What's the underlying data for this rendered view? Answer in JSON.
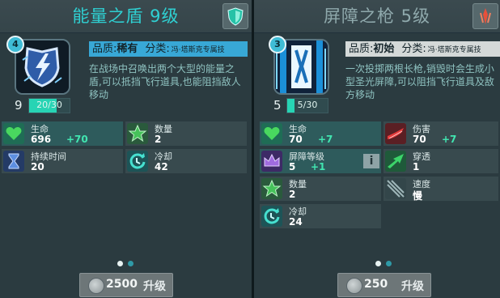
{
  "left": {
    "title": "能量之盾 9级",
    "level_badge": "4",
    "progress": {
      "level": "9",
      "text": "20/30",
      "fraction": 0.67
    },
    "quality_label": "品质:",
    "quality_value": "稀有",
    "category_label": "分类:",
    "category_value": "冯·塔斯克专属技",
    "description": "在战场中召唤出两个大型的能量之盾,可以抵挡飞行道具,也能阻挡敌人移动",
    "stats": [
      {
        "label": "生命",
        "value": "696",
        "bonus": "+70",
        "icon": "heart-icon"
      },
      {
        "label": "数量",
        "value": "2",
        "bonus": "",
        "icon": "star-icon"
      },
      {
        "label": "持续时间",
        "value": "20",
        "bonus": "",
        "icon": "hourglass-icon"
      },
      {
        "label": "冷却",
        "value": "42",
        "bonus": "",
        "icon": "cooldown-icon"
      }
    ],
    "upgrade": {
      "cost": "2500",
      "label": "升级",
      "coin_icon": "coin-icon"
    },
    "header_icon": "shield-icon"
  },
  "right": {
    "title": "屏障之枪 5级",
    "level_badge": "3",
    "progress": {
      "level": "5",
      "text": "5/30",
      "fraction": 0.17
    },
    "quality_label": "品质:",
    "quality_value": "初始",
    "category_label": "分类:",
    "category_value": "冯·塔斯克专属技",
    "description": "一次投掷两根长枪,销毁时会生成小型圣光屏障,可以阻挡飞行道具及敌方移动",
    "stats": [
      {
        "label": "生命",
        "value": "70",
        "bonus": "+7",
        "icon": "heart-icon"
      },
      {
        "label": "伤害",
        "value": "70",
        "bonus": "+7",
        "icon": "damage-icon"
      },
      {
        "label": "屏障等级",
        "value": "5",
        "bonus": "+1",
        "icon": "crown-icon"
      },
      {
        "label": "穿透",
        "value": "1",
        "bonus": "",
        "icon": "pierce-icon"
      },
      {
        "label": "数量",
        "value": "2",
        "bonus": "",
        "icon": "star-icon"
      },
      {
        "label": "速度",
        "value": "慢",
        "bonus": "",
        "icon": "speed-icon"
      },
      {
        "label": "冷却",
        "value": "24",
        "bonus": "",
        "icon": "cooldown-icon"
      }
    ],
    "info_button": "i",
    "upgrade": {
      "cost": "250",
      "label": "升级",
      "coin_icon": "coin-icon"
    },
    "header_icon": "spear-icon"
  },
  "colors": {
    "accent": "#2fd0d2",
    "bonus": "#41e5b0",
    "highlight_row": "#2e5b5c",
    "quality_rare": "#38a8d6",
    "quality_common": "#d4d9d8"
  },
  "pagination": {
    "pages": 2,
    "current": 1
  }
}
